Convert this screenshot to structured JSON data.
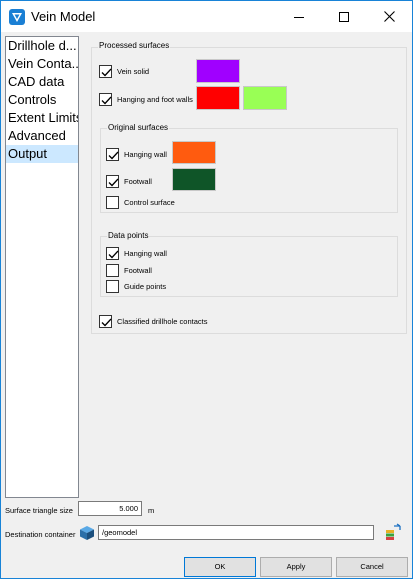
{
  "window": {
    "title": "Vein Model"
  },
  "nav": {
    "items": [
      {
        "label": "Drillhole d..."
      },
      {
        "label": "Vein Conta..."
      },
      {
        "label": "CAD data"
      },
      {
        "label": "Controls"
      },
      {
        "label": "Extent Limits"
      },
      {
        "label": "Advanced"
      },
      {
        "label": "Output",
        "selected": true
      }
    ]
  },
  "processed": {
    "title": "Processed surfaces",
    "vein_solid": {
      "label": "Vein solid",
      "checked": true,
      "color": "#a000ff"
    },
    "hanging_foot": {
      "label": "Hanging and foot walls",
      "checked": true,
      "color_hanging": "#ff0000",
      "color_foot": "#99ff55"
    }
  },
  "original": {
    "title": "Original surfaces",
    "hanging_wall": {
      "label": "Hanging wall",
      "checked": true,
      "color": "#ff5b0f"
    },
    "footwall": {
      "label": "Footwall",
      "checked": true,
      "color": "#0f5528"
    },
    "control_surface": {
      "label": "Control surface",
      "checked": false
    }
  },
  "datapoints": {
    "title": "Data points",
    "hanging_wall": {
      "label": "Hanging wall",
      "checked": true
    },
    "footwall": {
      "label": "Footwall",
      "checked": false
    },
    "guide_points": {
      "label": "Guide points",
      "checked": false
    }
  },
  "classified": {
    "label": "Classified drillhole contacts",
    "checked": true
  },
  "surface_triangle": {
    "label": "Surface triangle size",
    "value": "5.000",
    "unit": "m"
  },
  "destination": {
    "label": "Destination container",
    "value": "/geomodel"
  },
  "buttons": {
    "ok": "OK",
    "apply": "Apply",
    "cancel": "Cancel"
  },
  "icons": {
    "app": "vein-model-app-icon",
    "minimize": "minimize-icon",
    "maximize": "maximize-icon",
    "close": "close-icon",
    "container": "cube-container-icon",
    "browse": "layers-link-icon"
  },
  "colors": {
    "accent": "#1883d7",
    "selection": "#cce8ff"
  }
}
